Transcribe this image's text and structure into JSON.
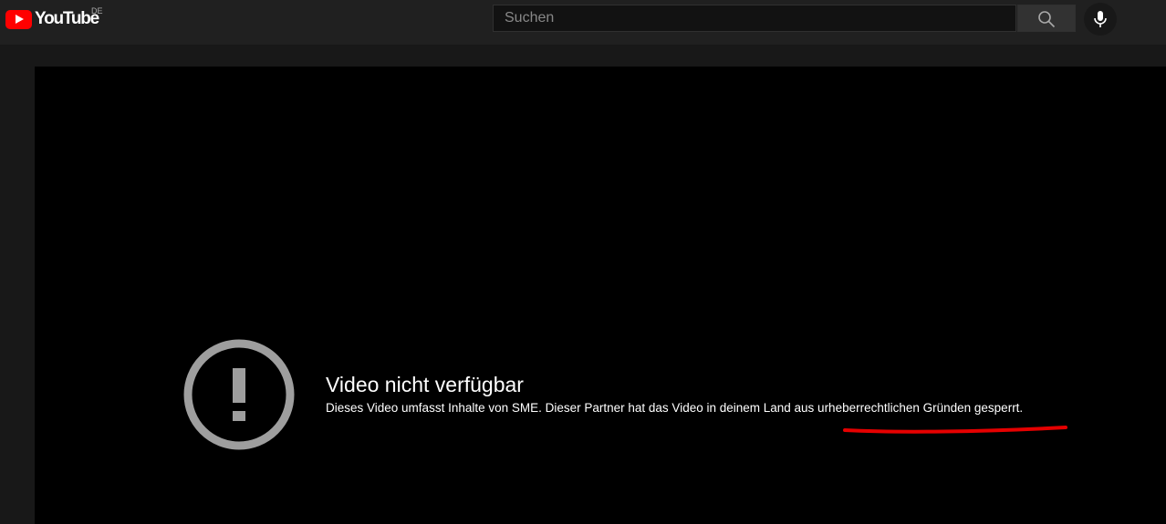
{
  "masthead": {
    "logo_text": "YouTube",
    "country_code": "DE",
    "search_placeholder": "Suchen",
    "search_icon": "search-icon",
    "mic_icon": "microphone-icon"
  },
  "player": {
    "error_icon": "alert-circle-icon",
    "error_title": "Video nicht verfügbar",
    "error_reason": "Dieses Video umfasst Inhalte von SME. Dieser Partner hat das Video in deinem Land aus urheberrechtlichen Gründen gesperrt."
  },
  "colors": {
    "brand": "#ff0000",
    "masthead_bg": "#202020",
    "page_bg": "#181818",
    "player_bg": "#000000",
    "annotation": "#e50000"
  }
}
